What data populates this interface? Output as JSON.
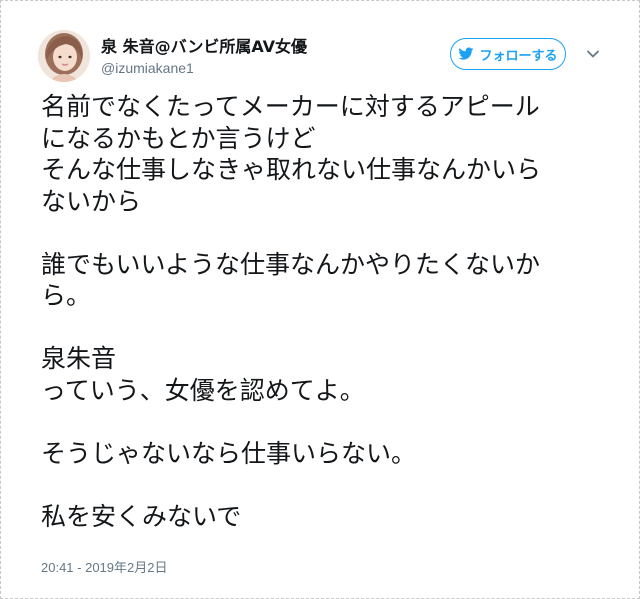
{
  "author": {
    "display_name": "泉 朱音@バンビ所属AV女優",
    "handle": "@izumiakane1",
    "avatar_icon": "user-avatar-photo"
  },
  "follow_button": {
    "label": "フォローする",
    "icon": "follow-bird-icon",
    "color": "#1da1f2"
  },
  "menu": {
    "icon": "chevron-down-icon"
  },
  "tweet": {
    "lines": [
      "名前でなくたってメーカーに対するアピール",
      "になるかもとか言うけど",
      "そんな仕事しなきゃ取れない仕事なんかいら",
      "ないから",
      "",
      "誰でもいいような仕事なんかやりたくないか",
      "ら。",
      "",
      "泉朱音",
      "っていう、女優を認めてよ。",
      "",
      "そうじゃないなら仕事いらない。",
      "",
      "私を安くみないで"
    ],
    "timestamp": "20:41 - 2019年2月2日"
  }
}
